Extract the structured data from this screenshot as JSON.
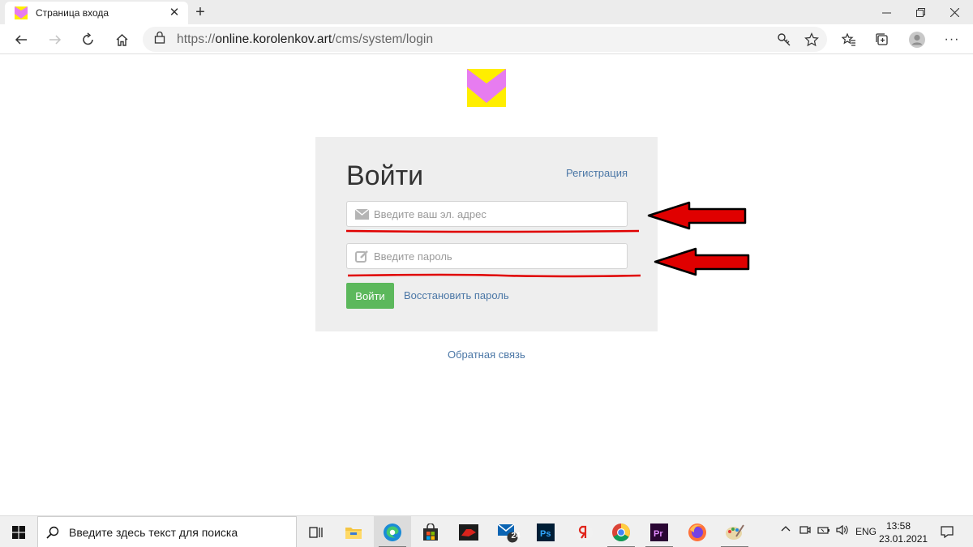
{
  "browser": {
    "tab_title": "Страница входа",
    "tab_close": "✕",
    "new_tab": "+",
    "url_scheme": "https://",
    "url_host": "online.korolenkov.art",
    "url_path": "/cms/system/login",
    "more": "···"
  },
  "login": {
    "title": "Войти",
    "register_link": "Регистрация",
    "email_placeholder": "Введите ваш эл. адрес",
    "password_placeholder": "Введите пароль",
    "submit_label": "Войти",
    "restore_link": "Восстановить пароль",
    "feedback_link": "Обратная связь"
  },
  "colors": {
    "logo_yellow": "#ffee00",
    "logo_pink": "#e77cf0",
    "submit_bg": "#5cb85c",
    "link": "#4b77a6",
    "annotation_red": "#e00000"
  },
  "taskbar": {
    "search_placeholder": "Введите здесь текст для поиска",
    "mail_badge": "24",
    "language": "ENG",
    "time": "13:58",
    "date": "23.01.2021"
  }
}
